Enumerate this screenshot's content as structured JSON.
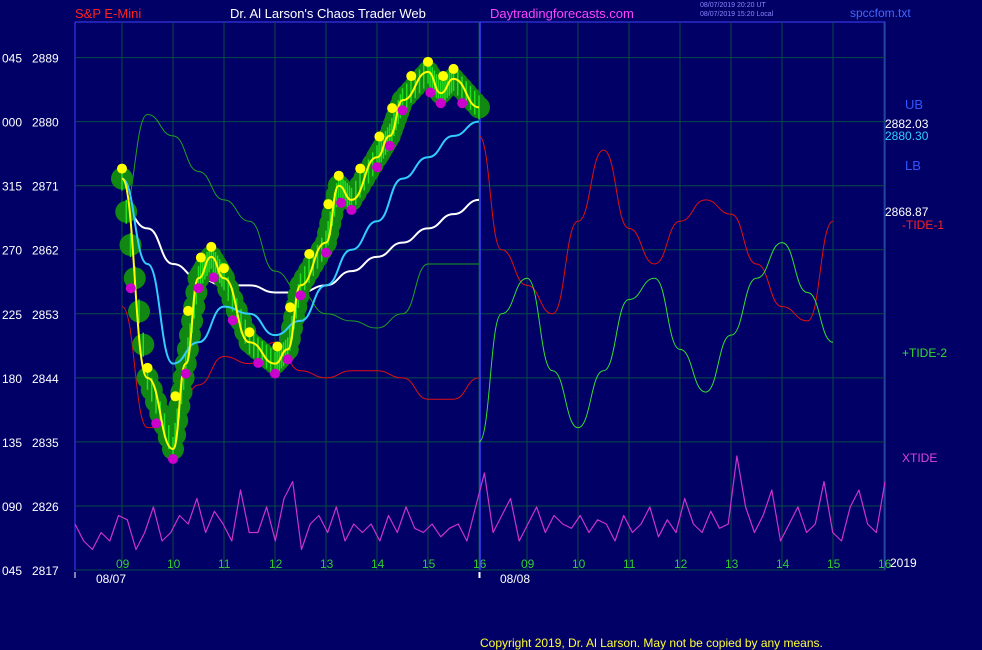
{
  "header": {
    "symbol": "S&P E-Mini",
    "title": "Dr. Al Larson's Chaos Trader Web",
    "site": "Daytradingforecasts.com",
    "timestamp_ut": "08/07/2019 20:20 UT",
    "timestamp_local": "08/07/2019 15:20 Local",
    "filename": "spccfom.txt"
  },
  "footer": {
    "copyright": "Copyright 2019, Dr. Al Larson. May not be copied by any means."
  },
  "colors": {
    "background": "#000066",
    "grid": "#0a4a44",
    "frame": "#4040ff",
    "price": "#ffff00",
    "ma_fast": "#33ccff",
    "ma_slow": "#ffffff",
    "ma_mid": "#2222ee",
    "bands": "#20a020",
    "tide1": "#dd1111",
    "tide2": "#33dd33",
    "xtide": "#cc33cc",
    "uptick": "#ffff00",
    "downtick": "#cc00cc",
    "axis_text": "#33cc33"
  },
  "chart_data": {
    "type": "line",
    "ylim": [
      2817,
      2894
    ],
    "yaxis_labels": [
      {
        "left": "045",
        "price": "2889"
      },
      {
        "left": "000",
        "price": "2880"
      },
      {
        "left": "315",
        "price": "2871"
      },
      {
        "left": "270",
        "price": "2862"
      },
      {
        "left": "225",
        "price": "2853"
      },
      {
        "left": "180",
        "price": "2844"
      },
      {
        "left": "135",
        "price": "2835"
      },
      {
        "left": "090",
        "price": "2826"
      },
      {
        "left": "045",
        "price": "2817"
      }
    ],
    "x_hours_day1": [
      "09",
      "10",
      "11",
      "12",
      "13",
      "14",
      "15",
      "16"
    ],
    "x_hours_day2": [
      "09",
      "10",
      "11",
      "12",
      "13",
      "14",
      "15",
      "16"
    ],
    "x_dates": [
      "08/07",
      "08/08"
    ],
    "x_year": "2019",
    "right_labels": {
      "ub": "UB",
      "lb": "LB",
      "price_ub": "2882.03",
      "price_fast": "2880.30",
      "price_slow": "2868.87",
      "tide1": "-TIDE-1",
      "tide2": "+TIDE-2",
      "xtide": "XTIDE"
    },
    "price": {
      "x": [
        9.0,
        9.5,
        10.0,
        10.25,
        10.5,
        10.75,
        11.0,
        11.5,
        12.0,
        12.25,
        12.5,
        13.0,
        13.25,
        13.5,
        14.0,
        14.25,
        14.5,
        15.0,
        15.25,
        15.5,
        16.0
      ],
      "y": [
        2872,
        2844,
        2834,
        2846,
        2858,
        2861,
        2858,
        2849,
        2846,
        2848,
        2857,
        2863,
        2871,
        2869,
        2875,
        2878,
        2883,
        2887,
        2884,
        2886,
        2882
      ]
    },
    "ma_fast": {
      "x": [
        9.0,
        9.5,
        10.0,
        10.5,
        11.0,
        11.5,
        12.0,
        12.5,
        13.0,
        13.5,
        14.0,
        14.5,
        15.0,
        15.5,
        16.0
      ],
      "y": [
        2872,
        2860,
        2846,
        2849,
        2854,
        2853,
        2850,
        2852,
        2857,
        2862,
        2866,
        2872,
        2875,
        2878,
        2880
      ]
    },
    "ma_slow": {
      "x": [
        9.0,
        9.5,
        10.0,
        10.5,
        11.0,
        11.5,
        12.0,
        12.5,
        13.0,
        13.5,
        14.0,
        14.5,
        15.0,
        15.5,
        16.0
      ],
      "y": [
        2868,
        2865,
        2860,
        2858,
        2857,
        2857,
        2856,
        2856,
        2857,
        2859,
        2861,
        2863,
        2865,
        2867,
        2869
      ]
    },
    "upper_band": {
      "x": [
        9.0,
        9.5,
        10.0,
        10.5,
        11.0,
        11.5,
        12.0,
        12.5,
        13.0,
        13.5,
        14.0,
        14.5,
        15.0,
        15.5,
        16.0
      ],
      "y": [
        2867,
        2881,
        2878,
        2873,
        2869,
        2866,
        2859,
        2856,
        2853,
        2852,
        2851,
        2853,
        2860,
        2860,
        2860
      ]
    },
    "lower_band": {
      "x": [
        9.0,
        9.5,
        10.0,
        10.5,
        11.0,
        11.5,
        12.0,
        12.5,
        13.0,
        13.5,
        14.0,
        14.5,
        15.0,
        15.5,
        16.0
      ],
      "y": [
        2854,
        2837,
        2837,
        2843,
        2847,
        2846,
        2849,
        2845,
        2844,
        2845,
        2845,
        2844,
        2841,
        2841,
        2844
      ]
    },
    "tide1": {
      "x": [
        16.0,
        16.5,
        17.0,
        17.5,
        18.0,
        18.5,
        19.0,
        19.5,
        20.0,
        20.5,
        21.0,
        21.5,
        22.0,
        22.5,
        23.0
      ],
      "y": [
        2878,
        2862,
        2857,
        2853,
        2866,
        2876,
        2865,
        2860,
        2866,
        2869,
        2867,
        2860,
        2854,
        2852,
        2866
      ]
    },
    "tide2": {
      "x": [
        16.0,
        16.5,
        17.0,
        17.5,
        18.0,
        18.5,
        19.0,
        19.5,
        20.0,
        20.5,
        21.0,
        21.5,
        22.0,
        22.5,
        23.0
      ],
      "y": [
        2835,
        2853,
        2858,
        2845,
        2837,
        2845,
        2855,
        2858,
        2848,
        2842,
        2850,
        2858,
        2863,
        2856,
        2849
      ]
    },
    "xtide_series": [
      0.4,
      0.2,
      0.1,
      0.3,
      0.2,
      0.5,
      0.45,
      0.1,
      0.3,
      0.6,
      0.2,
      0.3,
      0.5,
      0.4,
      0.7,
      0.3,
      0.55,
      0.4,
      0.2,
      0.8,
      0.3,
      0.3,
      0.6,
      0.2,
      0.7,
      0.9,
      0.1,
      0.4,
      0.5,
      0.3,
      0.6,
      0.2,
      0.4,
      0.3,
      0.4,
      0.2,
      0.5,
      0.3,
      0.6,
      0.35,
      0.3,
      0.4,
      0.25,
      0.35,
      0.4,
      0.2,
      0.6,
      1.0,
      0.3,
      0.5,
      0.7,
      0.2,
      0.4,
      0.6,
      0.3,
      0.5,
      0.4,
      0.35,
      0.5,
      0.3,
      0.45,
      0.4,
      0.2,
      0.5,
      0.3,
      0.4,
      0.6,
      0.25,
      0.45,
      0.3,
      0.7,
      0.4,
      0.3,
      0.55,
      0.35,
      0.4,
      1.2,
      0.6,
      0.3,
      0.5,
      0.8,
      0.2,
      0.4,
      0.6,
      0.3,
      0.4,
      0.9,
      0.3,
      0.2,
      0.6,
      0.8,
      0.4,
      0.3,
      0.9
    ]
  }
}
